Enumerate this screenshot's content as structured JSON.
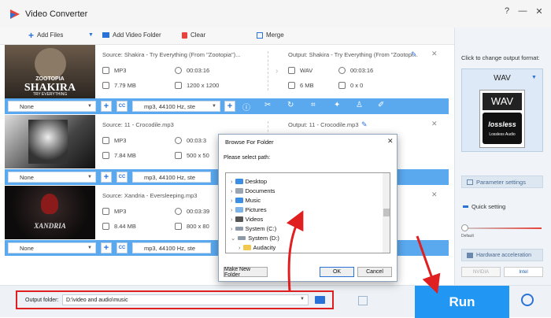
{
  "app": {
    "title": "Video Converter",
    "win_help": "?",
    "win_min": "—",
    "win_close": "✕"
  },
  "toolbar": {
    "add_files": "Add Files",
    "add_video_folder": "Add Video Folder",
    "clear": "Clear",
    "merge": "Merge"
  },
  "files": [
    {
      "source": "Source: Shakira - Try Everything (From \"Zootopia\")...",
      "format": "MP3",
      "duration": "00:03:16",
      "size": "7.79 MB",
      "resolution": "1200 x 1200",
      "output": "Output: Shakira - Try Everything (From \"Zootopi...",
      "out_format": "WAV",
      "out_duration": "00:03:16",
      "out_size": "6 MB",
      "out_resolution": "0 x 0",
      "subtitle": "None",
      "audio": "mp3, 44100 Hz, ste",
      "thumb_text": "SHAKIRA",
      "thumb_sub": "ZOOTOPIA",
      "thumb_tag": "TRY EVERYTHING"
    },
    {
      "source": "Source: 11 - Crocodile.mp3",
      "format": "MP3",
      "duration": "00:03:3",
      "size": "7.84 MB",
      "resolution": "500 x 50",
      "output": "Output: 11 - Crocodile.mp3",
      "subtitle": "None",
      "audio": "mp3, 44100 Hz, ste"
    },
    {
      "source": "Source: Xandria - Eversleeping.mp3",
      "format": "MP3",
      "duration": "00:03:39",
      "size": "8.44 MB",
      "resolution": "800 x 80",
      "subtitle": "None",
      "audio": "mp3, 44100 Hz, ste",
      "thumb_text": "XANDRIA"
    }
  ],
  "right_panel": {
    "hint": "Click to change output format:",
    "format": "WAV",
    "badge_top": "WAV",
    "badge_logo": "lossless",
    "badge_sub": "Lossless Audio",
    "param_settings": "Parameter settings",
    "quick_setting": "Quick setting",
    "default_label": "Default",
    "hw_accel": "Hardware acceleration",
    "nvidia": "NVIDIA",
    "intel": "Intel"
  },
  "bottom": {
    "output_label": "Output folder:",
    "output_path": "D:\\video and audio\\music",
    "run": "Run"
  },
  "dialog": {
    "title": "Browse For Folder",
    "prompt": "Please select path:",
    "tree": [
      "Desktop",
      "Documents",
      "Music",
      "Pictures",
      "Videos",
      "System (C:)",
      "System (D:)",
      "Audacity"
    ],
    "new_folder": "Make New Folder",
    "ok": "OK",
    "cancel": "Cancel"
  },
  "colors": {
    "accent": "#2a72d8",
    "bar": "#5aa9ef",
    "run_bg": "#2196f3",
    "highlight_red": "#e02020"
  }
}
